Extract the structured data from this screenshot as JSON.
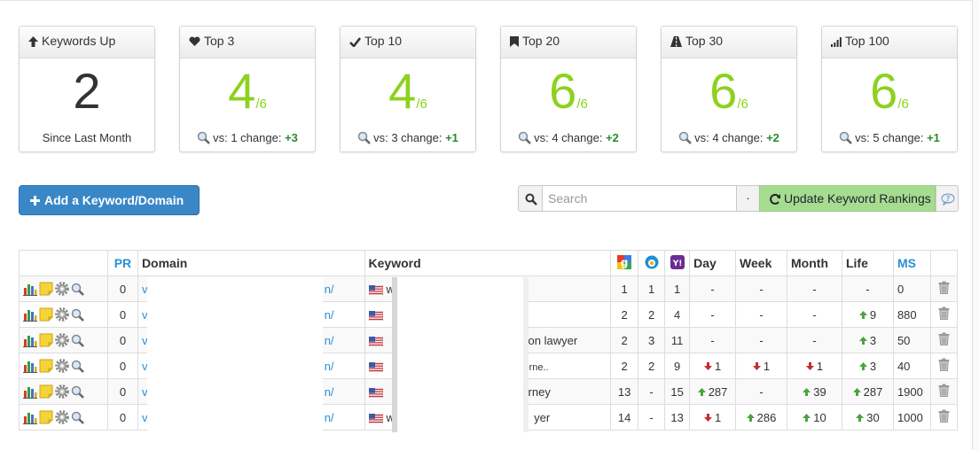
{
  "cards": [
    {
      "title": "Keywords Up",
      "icon": "arrow-up-icon",
      "value": "2",
      "denom": "",
      "footer": "Since Last Month",
      "vs": "",
      "change": ""
    },
    {
      "title": "Top 3",
      "icon": "heart-icon",
      "value": "4",
      "denom": "/6",
      "footer": "vs: 1 change:",
      "change": "+3"
    },
    {
      "title": "Top 10",
      "icon": "check-icon",
      "value": "4",
      "denom": "/6",
      "footer": "vs: 3 change:",
      "change": "+1"
    },
    {
      "title": "Top 20",
      "icon": "bookmark-icon",
      "value": "6",
      "denom": "/6",
      "footer": "vs: 4 change:",
      "change": "+2"
    },
    {
      "title": "Top 30",
      "icon": "road-icon",
      "value": "6",
      "denom": "/6",
      "footer": "vs: 4 change:",
      "change": "+2"
    },
    {
      "title": "Top 100",
      "icon": "signal-icon",
      "value": "6",
      "denom": "/6",
      "footer": "vs: 5 change:",
      "change": "+1"
    }
  ],
  "toolbar": {
    "add_label": "Add a Keyword/Domain",
    "search_placeholder": "Search",
    "dot": "·",
    "update_label": "Update Keyword Rankings"
  },
  "table": {
    "headers": {
      "pr": "PR",
      "domain": "Domain",
      "keyword": "Keyword",
      "day": "Day",
      "week": "Week",
      "month": "Month",
      "life": "Life",
      "ms": "MS"
    },
    "engines": [
      "google-icon",
      "bing-icon",
      "yahoo-icon"
    ],
    "rows": [
      {
        "pr": "0",
        "domain": "v",
        "domain_end": "n/",
        "keyword": "wo",
        "g": "1",
        "b": "1",
        "y": "1",
        "day": "-",
        "week": "-",
        "month": "-",
        "life": "-",
        "ms": "0",
        "day_dir": "",
        "week_dir": "",
        "month_dir": "",
        "life_dir": ""
      },
      {
        "pr": "0",
        "domain": "v",
        "domain_end": "n/",
        "keyword": "",
        "g": "2",
        "b": "2",
        "y": "4",
        "day": "-",
        "week": "-",
        "month": "-",
        "life": "9",
        "ms": "880",
        "day_dir": "",
        "week_dir": "",
        "month_dir": "",
        "life_dir": "up"
      },
      {
        "pr": "0",
        "domain": "v",
        "domain_end": "n/",
        "keyword": "on lawyer",
        "g": "2",
        "b": "3",
        "y": "11",
        "day": "-",
        "week": "-",
        "month": "-",
        "life": "3",
        "ms": "50",
        "day_dir": "",
        "week_dir": "",
        "month_dir": "",
        "life_dir": "up"
      },
      {
        "pr": "0",
        "domain": "v",
        "domain_end": "n/",
        "keyword": "orne..",
        "g": "2",
        "b": "2",
        "y": "9",
        "day": "1",
        "week": "1",
        "month": "1",
        "life": "3",
        "ms": "40",
        "day_dir": "down",
        "week_dir": "down",
        "month_dir": "down",
        "life_dir": "up"
      },
      {
        "pr": "0",
        "domain": "v",
        "domain_end": "n/",
        "keyword": "rney",
        "g": "13",
        "b": "-",
        "y": "15",
        "day": "287",
        "week": "-",
        "month": "39",
        "life": "287",
        "ms": "1900",
        "day_dir": "up",
        "week_dir": "",
        "month_dir": "up",
        "life_dir": "up"
      },
      {
        "pr": "0",
        "domain": "v",
        "domain_end": "n/",
        "keyword": "wo",
        "keyword_end": "yer",
        "g": "14",
        "b": "-",
        "y": "13",
        "day": "1",
        "week": "286",
        "month": "10",
        "life": "30",
        "ms": "1000",
        "day_dir": "down",
        "week_dir": "up",
        "month_dir": "up",
        "life_dir": "up"
      }
    ]
  }
}
